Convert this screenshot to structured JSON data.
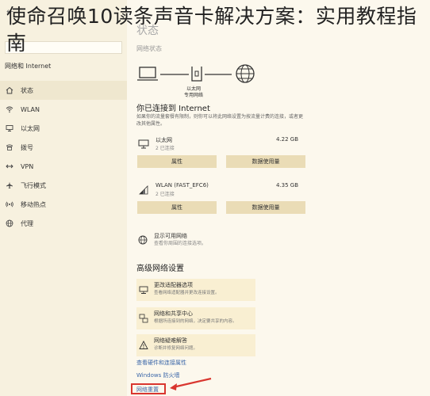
{
  "caption": "使命召唤10读条声音卡解决方案：实用教程指南",
  "window": {
    "back_symbol": "←",
    "sidebar": {
      "heading": "网络和 Internet",
      "items": [
        {
          "label": "状态",
          "icon": "home-icon"
        },
        {
          "label": "WLAN",
          "icon": "wifi-icon"
        },
        {
          "label": "以太网",
          "icon": "ethernet-icon"
        },
        {
          "label": "拨号",
          "icon": "dialup-icon"
        },
        {
          "label": "VPN",
          "icon": "vpn-icon"
        },
        {
          "label": "飞行模式",
          "icon": "airplane-icon"
        },
        {
          "label": "移动热点",
          "icon": "hotspot-icon"
        },
        {
          "label": "代理",
          "icon": "proxy-globe-icon"
        }
      ]
    },
    "main": {
      "title": "状态",
      "section_label": "网络状态",
      "diagram_labels": [
        "以太网",
        "专用网络"
      ],
      "connected_title": "你已连接到 Internet",
      "connected_desc": "如果你的流量套餐有限制，则你可以将此网络设置为按流量计费的连接，或者更改其他属性。",
      "adapters": [
        {
          "name": "以太网",
          "sub": "2 已连接",
          "usage": "4.22 GB",
          "btn_properties": "属性",
          "btn_usage": "数据使用量"
        },
        {
          "name": "WLAN (FAST_EFC6)",
          "sub": "2 已连接",
          "usage": "4.35 GB",
          "btn_properties": "属性",
          "btn_usage": "数据使用量"
        }
      ],
      "available": {
        "line1": "显示可用网络",
        "line2": "查看你周围的连接选项。"
      },
      "advanced_title": "高级网络设置",
      "advanced_items": [
        {
          "t1": "更改适配器选项",
          "t2": "查看网络适配器并更改连接设置。",
          "icon": "adapter-icon"
        },
        {
          "t1": "网络和共享中心",
          "t2": "根据所连接到的网络，决定要共享的内容。",
          "icon": "sharing-center-icon"
        },
        {
          "t1": "网络疑难解答",
          "t2": "诊断并修复网络问题。",
          "icon": "warning-icon"
        }
      ],
      "link_hardware": "查看硬件和连接属性",
      "link_firewall": "Windows 防火墙",
      "link_reset": "网络重置"
    }
  },
  "colors": {
    "accent_link": "#3a66a8",
    "highlight": "#d9362f",
    "button_bg": "#eadcb6"
  }
}
